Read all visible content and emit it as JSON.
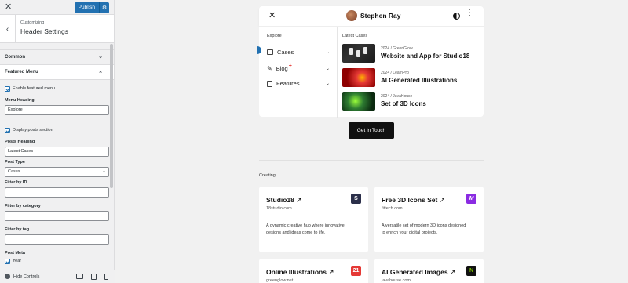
{
  "customizer": {
    "close_glyph": "✕",
    "publish_label": "Publish",
    "gear_glyph": "⚙",
    "back_glyph": "‹",
    "section_subtitle": "Customizing",
    "section_title": "Header Settings",
    "accordion_common": "Common",
    "accordion_featured": "Featured Menu",
    "chev_down": "⌄",
    "chev_up": "⌃",
    "enable_featured_label": "Enable featured menu",
    "menu_heading_label": "Menu Heading",
    "menu_heading_value": "Explore",
    "display_posts_label": "Display posts section",
    "posts_heading_label": "Posts Heading",
    "posts_heading_value": "Latest Cases",
    "post_type_label": "Post Type",
    "post_type_value": "Cases",
    "filter_id_label": "Filter by ID",
    "filter_category_label": "Filter by category",
    "filter_tag_label": "Filter by tag",
    "post_meta_label": "Post Meta",
    "year_label": "Year",
    "hide_controls_label": "Hide Controls"
  },
  "preview": {
    "header": {
      "close_glyph": "✕",
      "name": "Stephen Ray",
      "more_glyph": "⋮"
    },
    "menu": {
      "heading": "Explore",
      "items": [
        {
          "label": "Cases"
        },
        {
          "label": "Blog",
          "badge": "+"
        },
        {
          "label": "Features"
        }
      ],
      "chev": "⌄",
      "latest_heading": "Latest Cases",
      "cases": [
        {
          "meta": "2024 / GreenGlow",
          "title": "Website and App for Studio18"
        },
        {
          "meta": "2024 / LearnPro",
          "title": "AI Generated Illustrations"
        },
        {
          "meta": "2024 / JavaHouse",
          "title": "Set of 3D Icons"
        }
      ]
    },
    "cta_label": "Get in Touch",
    "creating_label": "Creating",
    "projects": [
      {
        "title": "Studio18",
        "arrow": "↗",
        "domain": "18studio.com",
        "desc": "A dynamic creative hub where innovative designs and ideas come to life.",
        "logo_text": "S",
        "logo_color": "#2b2f4a"
      },
      {
        "title": "Free 3D Icons Set",
        "arrow": "↗",
        "domain": "fittech.com",
        "desc": "A versatile set of modern 3D icons designed to enrich your digital projects.",
        "logo_text": "M",
        "logo_color": "#8a2be2"
      },
      {
        "title": "Online Illustrations",
        "arrow": "↗",
        "domain": "greenglow.net",
        "logo_text": "21",
        "logo_color": "#e53935"
      },
      {
        "title": "AI Generated Images",
        "arrow": "↗",
        "domain": "javahouse.com",
        "logo_text": "N",
        "logo_color": "#7cc400"
      }
    ],
    "colors": {
      "accent": "#2271b1",
      "cta": "#111111"
    }
  }
}
